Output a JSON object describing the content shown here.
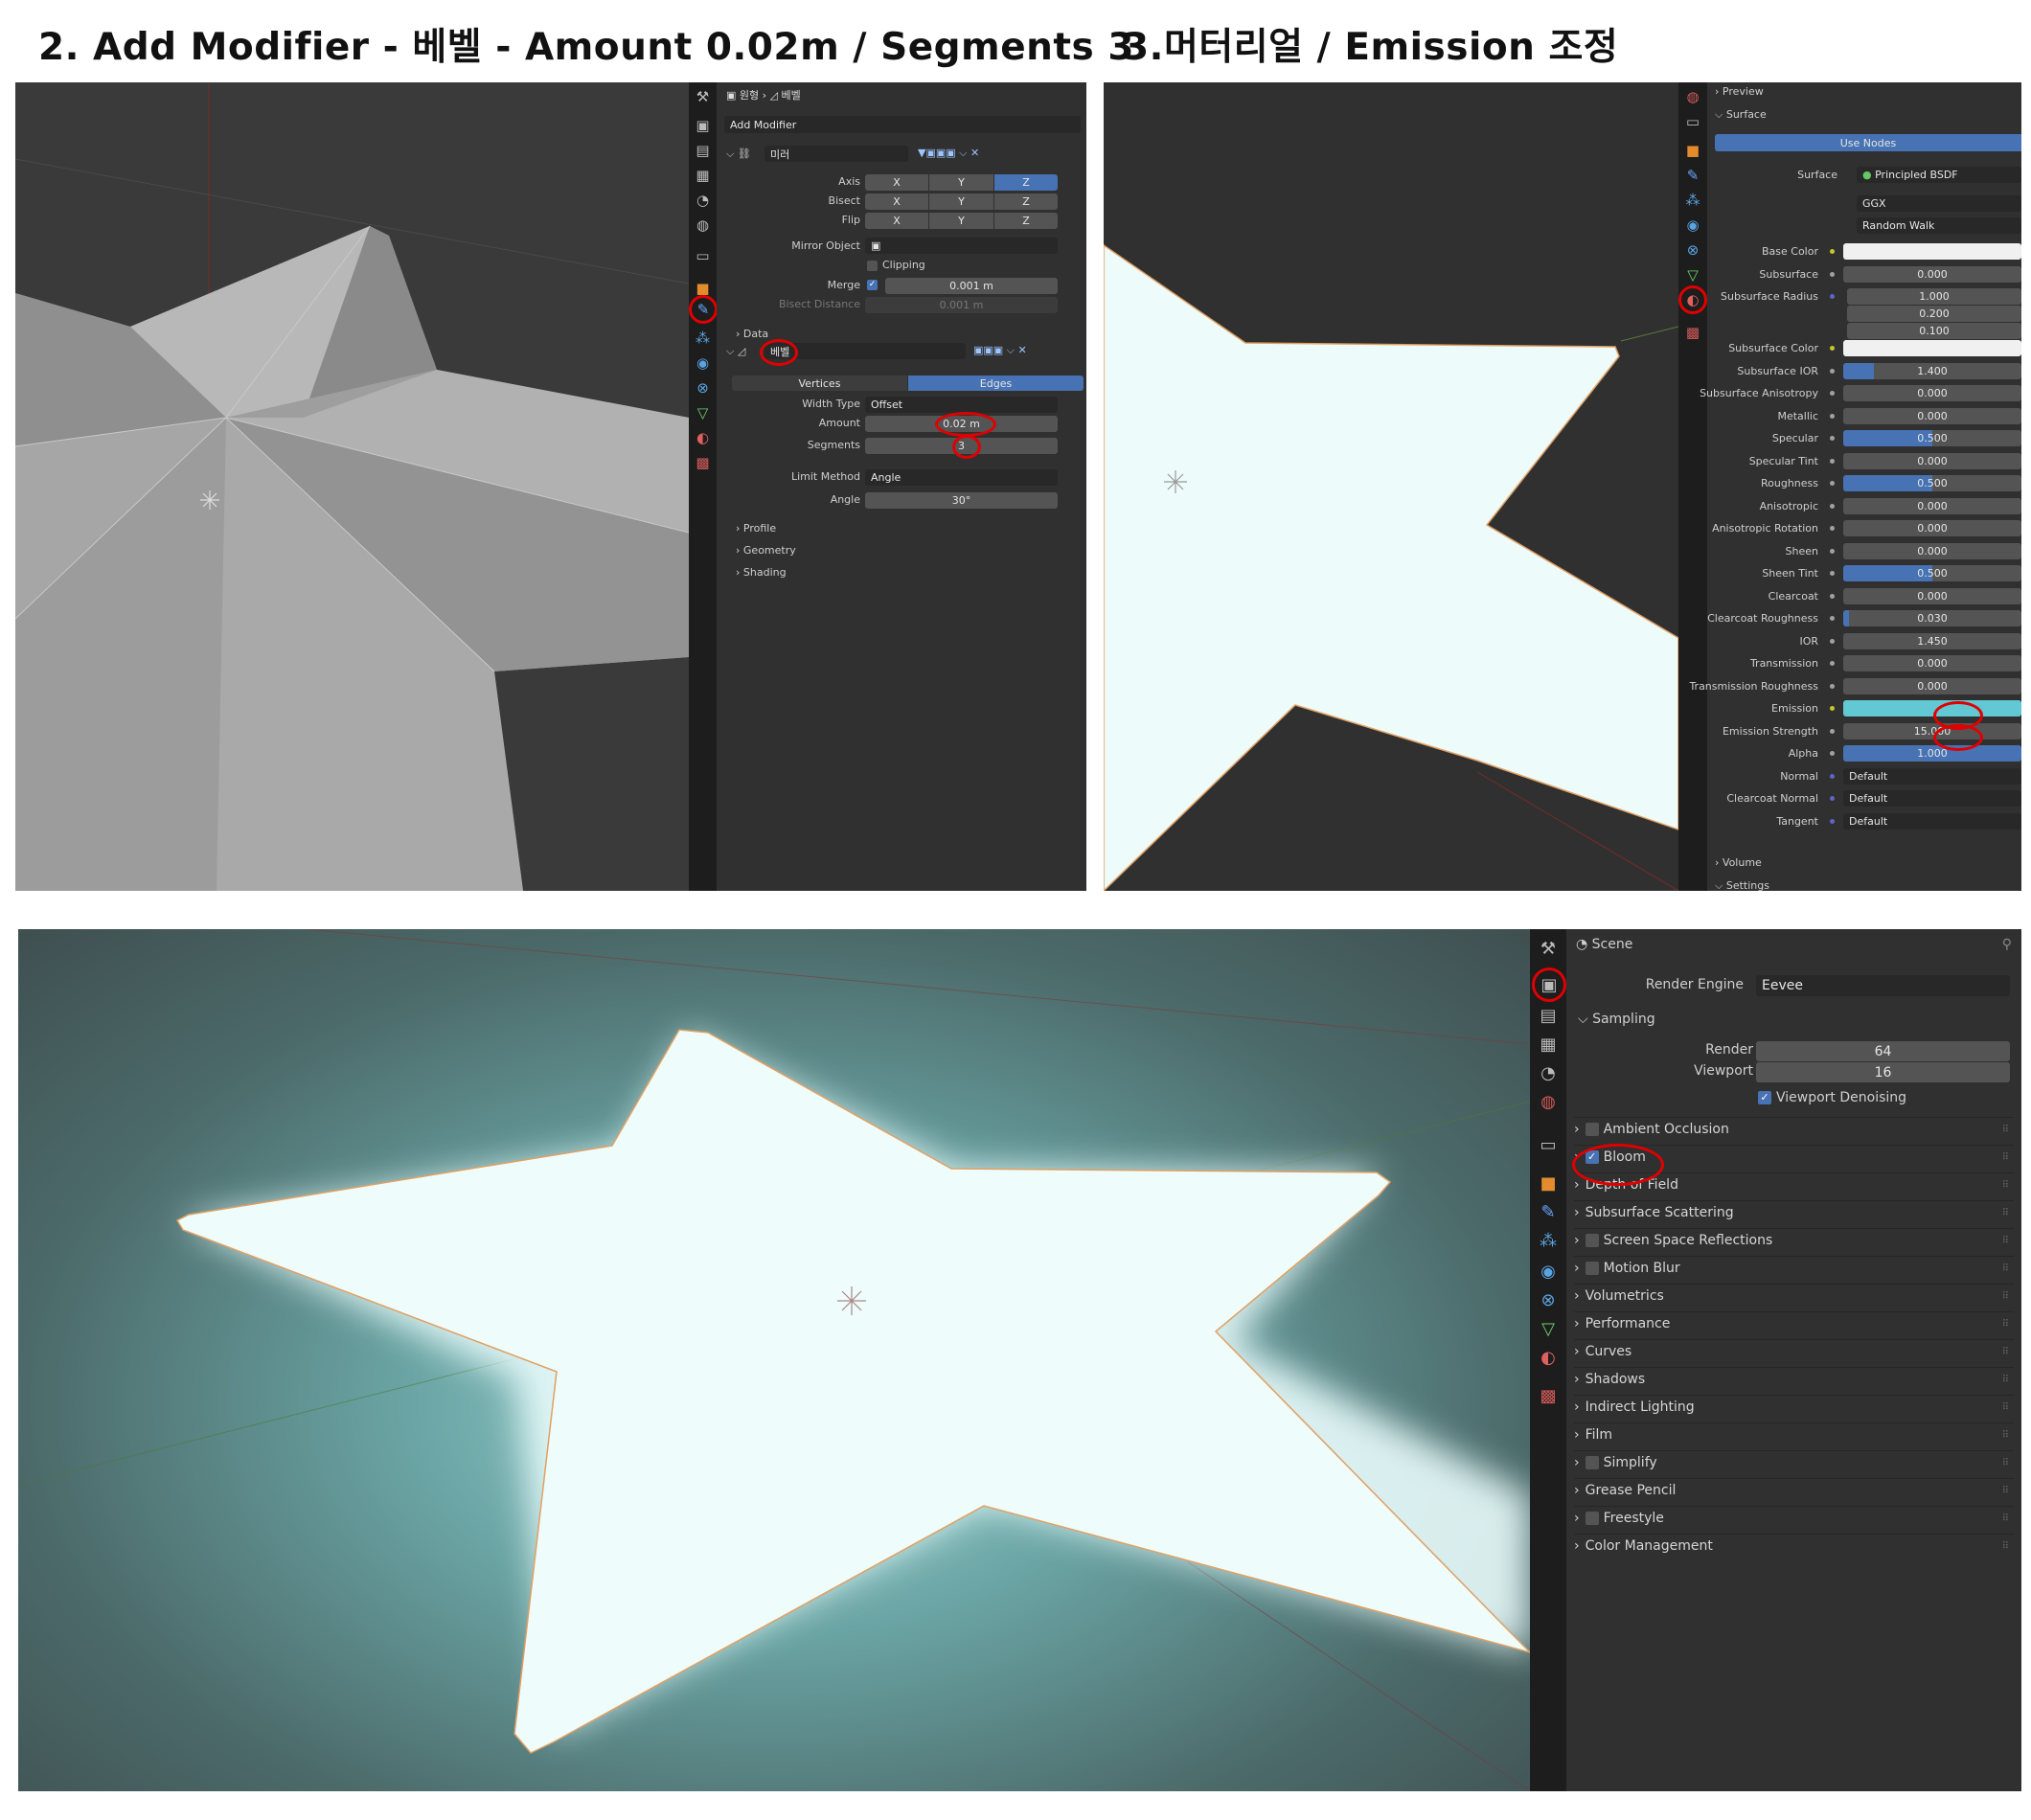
{
  "headings": {
    "step2": "2. Add Modifier - 베벨 - Amount 0.02m / Segments 3",
    "step3": "3.머터리얼 / Emission 조정"
  },
  "modifier_panel": {
    "breadcrumb_object": "원형",
    "breadcrumb_modifier": "베벨",
    "add_modifier": "Add Modifier",
    "mirror": {
      "name": "미러",
      "axis_label": "Axis",
      "bisect_label": "Bisect",
      "flip_label": "Flip",
      "axis_x": "X",
      "axis_y": "Y",
      "axis_z": "Z",
      "mirror_object_label": "Mirror Object",
      "clipping_label": "Clipping",
      "merge_label": "Merge",
      "merge_value": "0.001 m",
      "bisect_distance_label": "Bisect Distance",
      "bisect_distance_value": "0.001 m",
      "data_label": "Data"
    },
    "bevel": {
      "name": "베벨",
      "vertices_tab": "Vertices",
      "edges_tab": "Edges",
      "width_type_label": "Width Type",
      "width_type_value": "Offset",
      "amount_label": "Amount",
      "amount_value": "0.02 m",
      "segments_label": "Segments",
      "segments_value": "3",
      "limit_method_label": "Limit Method",
      "limit_method_value": "Angle",
      "angle_label": "Angle",
      "angle_value": "30°",
      "profile": "Profile",
      "geometry": "Geometry",
      "shading": "Shading"
    }
  },
  "material_panel": {
    "preview": "Preview",
    "surface_section": "Surface",
    "use_nodes": "Use Nodes",
    "surface_label": "Surface",
    "surface_value": "Principled BSDF",
    "distribution": "GGX",
    "subsurface_method": "Random Walk",
    "rows": [
      {
        "label": "Base Color",
        "value": "",
        "kind": "color",
        "color": "#f0f0f0",
        "socket": "#c7c729"
      },
      {
        "label": "Subsurface",
        "value": "0.000",
        "kind": "num",
        "fill": 0,
        "socket": "#a1a1a1"
      },
      {
        "label": "Subsurface Radius",
        "value": "1.000",
        "kind": "vec",
        "socket": "#6363c7"
      },
      {
        "label": "",
        "value": "0.200",
        "kind": "vecsub"
      },
      {
        "label": "",
        "value": "0.100",
        "kind": "vecsub"
      },
      {
        "label": "Subsurface Color",
        "value": "",
        "kind": "color",
        "color": "#f0f0f0",
        "socket": "#c7c729"
      },
      {
        "label": "Subsurface IOR",
        "value": "1.400",
        "kind": "num",
        "fill": 0.17,
        "socket": "#a1a1a1"
      },
      {
        "label": "Subsurface Anisotropy",
        "value": "0.000",
        "kind": "num",
        "fill": 0,
        "socket": "#a1a1a1"
      },
      {
        "label": "Metallic",
        "value": "0.000",
        "kind": "num",
        "fill": 0,
        "socket": "#a1a1a1"
      },
      {
        "label": "Specular",
        "value": "0.500",
        "kind": "num",
        "fill": 0.5,
        "socket": "#a1a1a1"
      },
      {
        "label": "Specular Tint",
        "value": "0.000",
        "kind": "num",
        "fill": 0,
        "socket": "#a1a1a1"
      },
      {
        "label": "Roughness",
        "value": "0.500",
        "kind": "num",
        "fill": 0.5,
        "socket": "#a1a1a1"
      },
      {
        "label": "Anisotropic",
        "value": "0.000",
        "kind": "num",
        "fill": 0,
        "socket": "#a1a1a1"
      },
      {
        "label": "Anisotropic Rotation",
        "value": "0.000",
        "kind": "num",
        "fill": 0,
        "socket": "#a1a1a1"
      },
      {
        "label": "Sheen",
        "value": "0.000",
        "kind": "num",
        "fill": 0,
        "socket": "#a1a1a1"
      },
      {
        "label": "Sheen Tint",
        "value": "0.500",
        "kind": "num",
        "fill": 0.5,
        "socket": "#a1a1a1"
      },
      {
        "label": "Clearcoat",
        "value": "0.000",
        "kind": "num",
        "fill": 0,
        "socket": "#a1a1a1"
      },
      {
        "label": "Clearcoat Roughness",
        "value": "0.030",
        "kind": "num",
        "fill": 0.03,
        "socket": "#a1a1a1"
      },
      {
        "label": "IOR",
        "value": "1.450",
        "kind": "num",
        "fill": 0,
        "socket": "#a1a1a1"
      },
      {
        "label": "Transmission",
        "value": "0.000",
        "kind": "num",
        "fill": 0,
        "socket": "#a1a1a1"
      },
      {
        "label": "Transmission Roughness",
        "value": "0.000",
        "kind": "num",
        "fill": 0,
        "socket": "#a1a1a1"
      },
      {
        "label": "Emission",
        "value": "",
        "kind": "color",
        "color": "#62c8d3",
        "socket": "#c7c729"
      },
      {
        "label": "Emission Strength",
        "value": "15.000",
        "kind": "num",
        "fill": 0,
        "socket": "#a1a1a1"
      },
      {
        "label": "Alpha",
        "value": "1.000",
        "kind": "num",
        "fill": 1,
        "socket": "#a1a1a1"
      },
      {
        "label": "Normal",
        "value": "Default",
        "kind": "text",
        "socket": "#6363c7"
      },
      {
        "label": "Clearcoat Normal",
        "value": "Default",
        "kind": "text",
        "socket": "#6363c7"
      },
      {
        "label": "Tangent",
        "value": "Default",
        "kind": "text",
        "socket": "#6363c7"
      }
    ],
    "volume": "Volume",
    "settings": "Settings"
  },
  "render_panel": {
    "scene": "Scene",
    "render_engine_label": "Render Engine",
    "render_engine_value": "Eevee",
    "sampling": "Sampling",
    "render_label": "Render",
    "render_value": "64",
    "viewport_label": "Viewport",
    "viewport_value": "16",
    "viewport_denoising": "Viewport Denoising",
    "sections": [
      {
        "label": "Ambient Occlusion",
        "checkbox": true,
        "checked": false
      },
      {
        "label": "Bloom",
        "checkbox": true,
        "checked": true
      },
      {
        "label": "Depth of Field",
        "checkbox": false,
        "checked": false
      },
      {
        "label": "Subsurface Scattering",
        "checkbox": false,
        "checked": false
      },
      {
        "label": "Screen Space Reflections",
        "checkbox": true,
        "checked": false
      },
      {
        "label": "Motion Blur",
        "checkbox": true,
        "checked": false
      },
      {
        "label": "Volumetrics",
        "checkbox": false,
        "checked": false
      },
      {
        "label": "Performance",
        "checkbox": false,
        "checked": false
      },
      {
        "label": "Curves",
        "checkbox": false,
        "checked": false
      },
      {
        "label": "Shadows",
        "checkbox": false,
        "checked": false
      },
      {
        "label": "Indirect Lighting",
        "checkbox": false,
        "checked": false
      },
      {
        "label": "Film",
        "checkbox": false,
        "checked": false
      },
      {
        "label": "Simplify",
        "checkbox": true,
        "checked": false
      },
      {
        "label": "Grease Pencil",
        "checkbox": false,
        "checked": false
      },
      {
        "label": "Freestyle",
        "checkbox": true,
        "checked": false
      },
      {
        "label": "Color Management",
        "checkbox": false,
        "checked": false
      }
    ]
  },
  "icons": {
    "tool": "tool-icon",
    "render": "render-properties-icon",
    "output": "output-icon",
    "view_layer": "view-layer-icon",
    "scene": "scene-icon",
    "world": "world-icon",
    "collection": "collection-icon",
    "object": "object-icon",
    "modifier": "wrench-icon",
    "particles": "particles-icon",
    "physics": "physics-icon",
    "constraints": "constraints-icon",
    "data": "mesh-data-icon",
    "material": "material-icon",
    "texture": "texture-icon"
  },
  "colors": {
    "ui_bg": "#303030",
    "tab_bg": "#1d1d1d",
    "field": "#545454",
    "accent": "#4772b3",
    "highlight_ring": "#e00000",
    "emission": "#62c8d3",
    "star_glow": "#eefbfb",
    "edge_orange": "#e0a062"
  }
}
